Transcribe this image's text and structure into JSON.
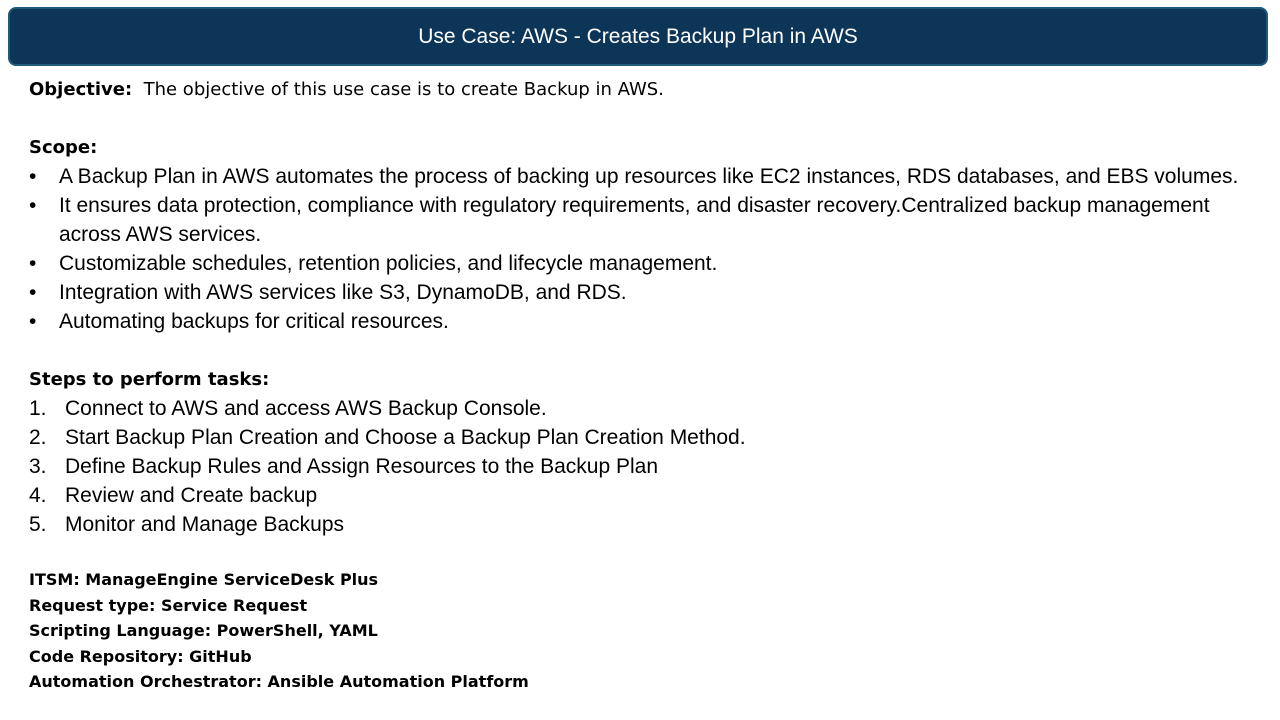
{
  "title": "Use Case:  AWS - Creates Backup Plan in AWS",
  "objective": {
    "label": "Objective:",
    "text": "The objective of this use case is to create Backup in AWS."
  },
  "scope": {
    "label": "Scope:",
    "items": [
      "A Backup Plan in AWS automates the process of backing up resources like EC2 instances, RDS databases, and EBS volumes.",
      "It ensures data protection, compliance with regulatory requirements, and disaster recovery.Centralized backup management across AWS services.",
      "Customizable schedules, retention policies, and lifecycle management.",
      "Integration with AWS services like S3, DynamoDB, and RDS.",
      "Automating backups for critical resources."
    ]
  },
  "steps": {
    "label": "Steps to perform tasks:",
    "items": [
      "Connect to AWS and access AWS Backup Console.",
      "Start Backup Plan Creation and Choose a Backup Plan Creation Method.",
      "Define Backup Rules and Assign Resources to the Backup Plan",
      "Review and Create backup",
      "Monitor and Manage Backups"
    ]
  },
  "meta": [
    "ITSM: ManageEngine ServiceDesk Plus",
    "Request type: Service Request",
    "Scripting Language: PowerShell, YAML",
    "Code Repository: GitHub",
    "Automation Orchestrator: Ansible Automation Platform"
  ]
}
